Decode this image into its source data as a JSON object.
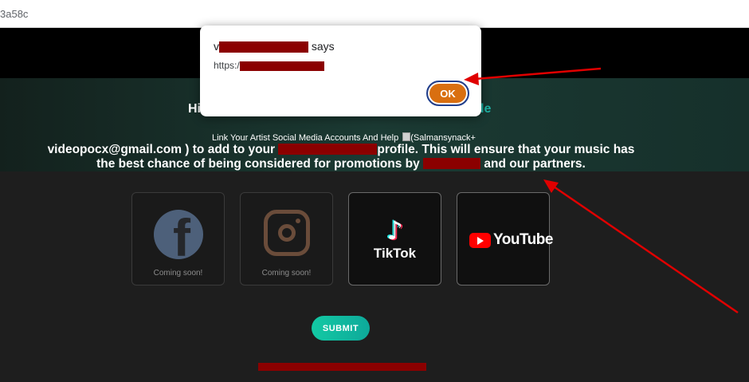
{
  "browser": {
    "address_fragment": "3a58c"
  },
  "hero": {
    "title_left": "Hi",
    "title_right": "le",
    "link_prefix": "Link Your Artist Social Media Accounts And Help",
    "link_suffix": "(Salmansynack+",
    "line1_start": "videopocx@gmail.com ) to add to your",
    "line1_end": "profile. This will ensure that your music has",
    "line2_start": "the best chance of being considered for promotions by",
    "line2_end": "and our partners."
  },
  "social_cards": [
    {
      "platform": "Facebook",
      "icon": "facebook-icon",
      "status": "Coming soon!"
    },
    {
      "platform": "Instagram",
      "icon": "instagram-icon",
      "status": "Coming soon!"
    },
    {
      "platform": "TikTok",
      "icon": "tiktok-icon",
      "label": "TikTok"
    },
    {
      "platform": "YouTube",
      "icon": "youtube-icon",
      "label": "YouTube"
    }
  ],
  "submit_label": "SUBMIT",
  "dialog": {
    "title_suffix": "says",
    "message_prefix": "https:/",
    "ok_label": "OK"
  },
  "colors": {
    "accent_teal": "#1fb6a8",
    "redaction": "#8b0000",
    "ok_button": "#d96f10",
    "annotation_arrow": "#e00000"
  }
}
